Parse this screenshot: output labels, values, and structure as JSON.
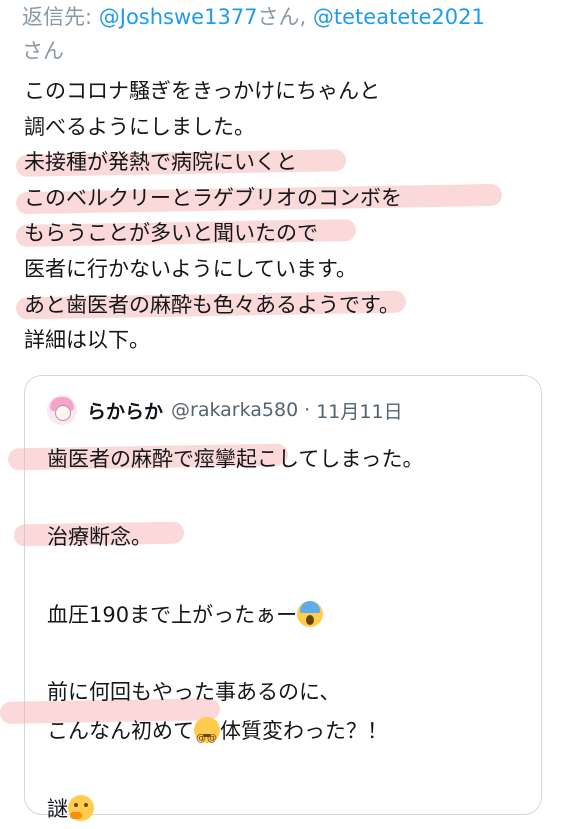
{
  "reply": {
    "prefix": "返信先: ",
    "handle1": "@Joshswe1377",
    "mid": "さん, ",
    "handle2": "@teteatete2021",
    "suffix": "さん"
  },
  "tweet": {
    "lines": [
      "このコロナ騒ぎをきっかけにちゃんと",
      "調べるようにしました。",
      "未接種が発熱で病院にいくと",
      "このベルクリーとラゲブリオのコンボを",
      "もらうことが多いと聞いたので",
      "医者に行かないようにしています。",
      "あと歯医者の麻酔も色々あるようです。",
      "詳細は以下。"
    ]
  },
  "quote": {
    "name": "らからか",
    "handle": "@rakarka580",
    "separator": "·",
    "date": "11月11日",
    "lines": [
      "歯医者の麻酔で痙攣起こしてしまった。",
      "",
      "治療断念。",
      "",
      "血圧190まで上がったぁー",
      "",
      "前に何回もやった事あるのに、",
      "こんなん初めて",
      "体質変わった？！",
      "",
      "謎"
    ]
  },
  "icons": {
    "avatar": "anime-avatar",
    "emoji1": "face-screaming-in-fear",
    "emoji2": "dizzy-face",
    "emoji3": "thinking-face"
  }
}
